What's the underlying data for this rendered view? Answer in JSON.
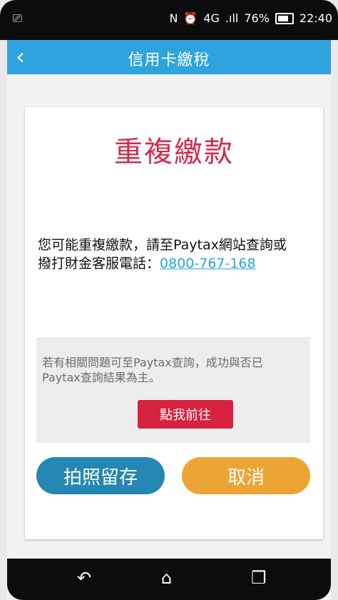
{
  "status_bar": {
    "nfc_icon": "N",
    "alarm_icon": "⏰",
    "network": "4G",
    "signal": ".ıll",
    "battery": "76%",
    "time": "22:40"
  },
  "header": {
    "title": "信用卡繳稅"
  },
  "card": {
    "title": "重複繳款",
    "message_line1": "您可能重複繳款，請至Paytax網站查詢或",
    "message_line2": "撥打財金客服電話：",
    "phone": "0800-767-168",
    "note_line1": "若有相關問題可至Paytax查詢，成功與否已",
    "note_line2": "Paytax查詢結果為主。",
    "go_label": "點我前往",
    "save_label": "拍照留存",
    "cancel_label": "取消"
  },
  "colors": {
    "accent": "#2ea3dd",
    "title_red": "#d32a4a",
    "save_blue": "#2587b3",
    "cancel_orange": "#eca534",
    "go_red": "#d72240"
  }
}
